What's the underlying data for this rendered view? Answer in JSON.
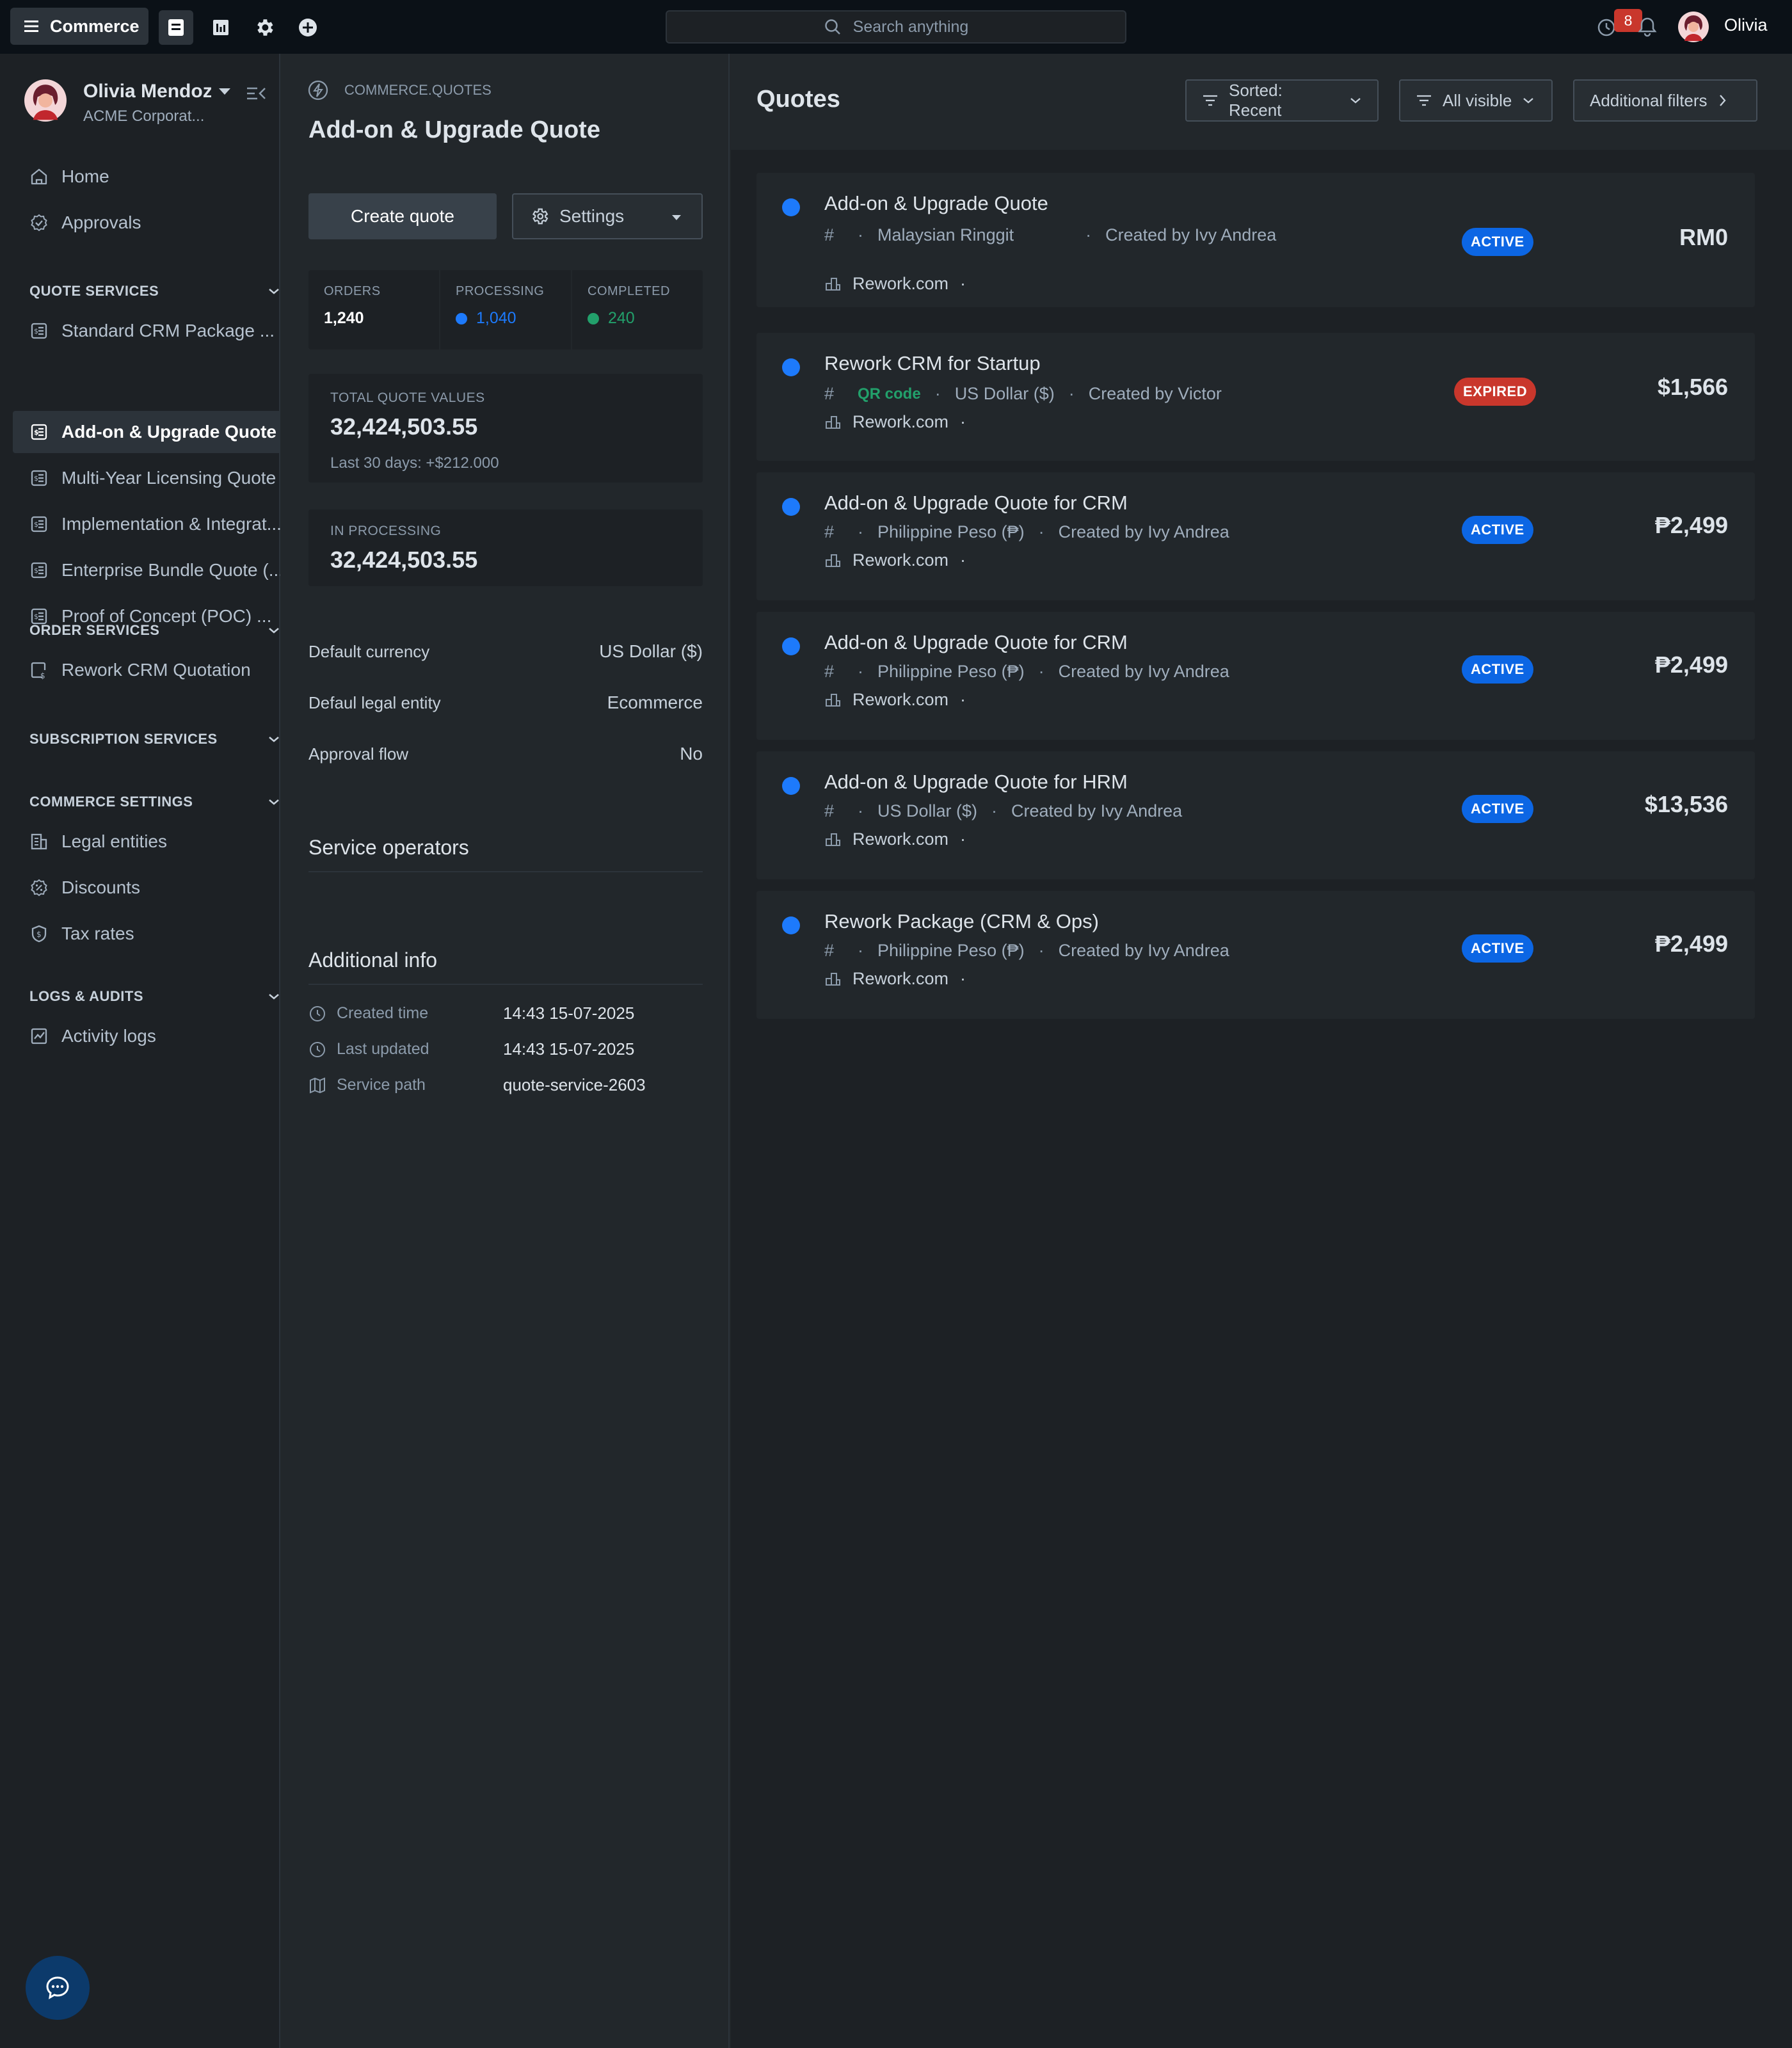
{
  "topbar": {
    "app_name": "Commerce",
    "search_placeholder": "Search anything",
    "notification_count": "8",
    "user_name": "Olivia"
  },
  "sidebar": {
    "profile": {
      "name": "Olivia Mendoza",
      "org": "ACME Corporat..."
    },
    "top_items": [
      {
        "label": "Home",
        "icon": "home-icon"
      },
      {
        "label": "Approvals",
        "icon": "approvals-icon"
      }
    ],
    "sections": [
      {
        "title": "QUOTE SERVICES",
        "items": [
          {
            "label": "Standard CRM Package ...",
            "active": false
          },
          {
            "label": "Add-on & Upgrade Quote",
            "active": true
          },
          {
            "label": "Multi-Year Licensing Quote",
            "active": false
          },
          {
            "label": "Implementation & Integrat...",
            "active": false
          },
          {
            "label": "Enterprise Bundle Quote (...",
            "active": false
          },
          {
            "label": "Proof of Concept (POC) ...",
            "active": false
          }
        ]
      },
      {
        "title": "ORDER SERVICES",
        "items": [
          {
            "label": "Rework CRM Quotation"
          }
        ]
      },
      {
        "title": "SUBSCRIPTION SERVICES",
        "items": []
      },
      {
        "title": "COMMERCE SETTINGS",
        "items": [
          {
            "label": "Legal entities"
          },
          {
            "label": "Discounts"
          },
          {
            "label": "Tax rates"
          }
        ]
      },
      {
        "title": "LOGS & AUDITS",
        "items": [
          {
            "label": "Activity logs"
          }
        ]
      }
    ]
  },
  "detail": {
    "breadcrumb": "COMMERCE.QUOTES",
    "title": "Add-on & Upgrade Quote",
    "create_label": "Create quote",
    "settings_label": "Settings",
    "stats": {
      "orders_label": "ORDERS",
      "orders": "1,240",
      "processing_label": "PROCESSING",
      "processing": "1,040",
      "completed_label": "COMPLETED",
      "completed": "240"
    },
    "total_label": "TOTAL QUOTE VALUES",
    "total_value": "32,424,503.55",
    "total_sub": "Last 30 days: +$212.000",
    "processing_total_label": "IN PROCESSING",
    "processing_total_value": "32,424,503.55",
    "props": [
      {
        "k": "Default currency",
        "v": "US Dollar ($)"
      },
      {
        "k": "Defaul legal entity",
        "v": "Ecommerce"
      },
      {
        "k": "Approval flow",
        "v": "No"
      }
    ],
    "service_operators_heading": "Service operators",
    "additional_info_heading": "Additional info",
    "info": [
      {
        "k": "Created time",
        "v": "14:43 15-07-2025"
      },
      {
        "k": "Last updated",
        "v": "14:43 15-07-2025"
      },
      {
        "k": "Service path",
        "v": "quote-service-2603"
      }
    ]
  },
  "quotes": {
    "title": "Quotes",
    "sort_label": "Sorted: Recent",
    "visibility_label": "All visible",
    "filters_label": "Additional filters",
    "list": [
      {
        "title": "Add-on & Upgrade Quote",
        "qr": "",
        "currency": "Malaysian Ringgit",
        "creator": "Created by Ivy Andrea",
        "site": "Rework.com",
        "status": "ACTIVE",
        "amount": "RM0"
      },
      {
        "title": "Rework CRM for Startup",
        "qr": "QR code",
        "currency": "US Dollar ($)",
        "creator": "Created by Victor",
        "site": "Rework.com",
        "status": "EXPIRED",
        "amount": "$1,566"
      },
      {
        "title": "Add-on & Upgrade Quote for CRM",
        "qr": "",
        "currency": "Philippine Peso (₱)",
        "creator": "Created by Ivy Andrea",
        "site": "Rework.com",
        "status": "ACTIVE",
        "amount": "₱2,499"
      },
      {
        "title": "Add-on & Upgrade Quote for CRM",
        "qr": "",
        "currency": "Philippine Peso (₱)",
        "creator": "Created by Ivy Andrea",
        "site": "Rework.com",
        "status": "ACTIVE",
        "amount": "₱2,499"
      },
      {
        "title": "Add-on & Upgrade Quote for HRM",
        "qr": "",
        "currency": "US Dollar ($)",
        "creator": "Created by Ivy Andrea",
        "site": "Rework.com",
        "status": "ACTIVE",
        "amount": "$13,536"
      },
      {
        "title": "Rework Package (CRM & Ops)",
        "qr": "",
        "currency": "Philippine Peso (₱)",
        "creator": "Created by Ivy Andrea",
        "site": "Rework.com",
        "status": "ACTIVE",
        "amount": "₱2,499"
      }
    ]
  },
  "colors": {
    "accent": "#1d7afc",
    "success": "#22a06b",
    "danger": "#c9372c",
    "badge_active": "#0c66e4"
  }
}
